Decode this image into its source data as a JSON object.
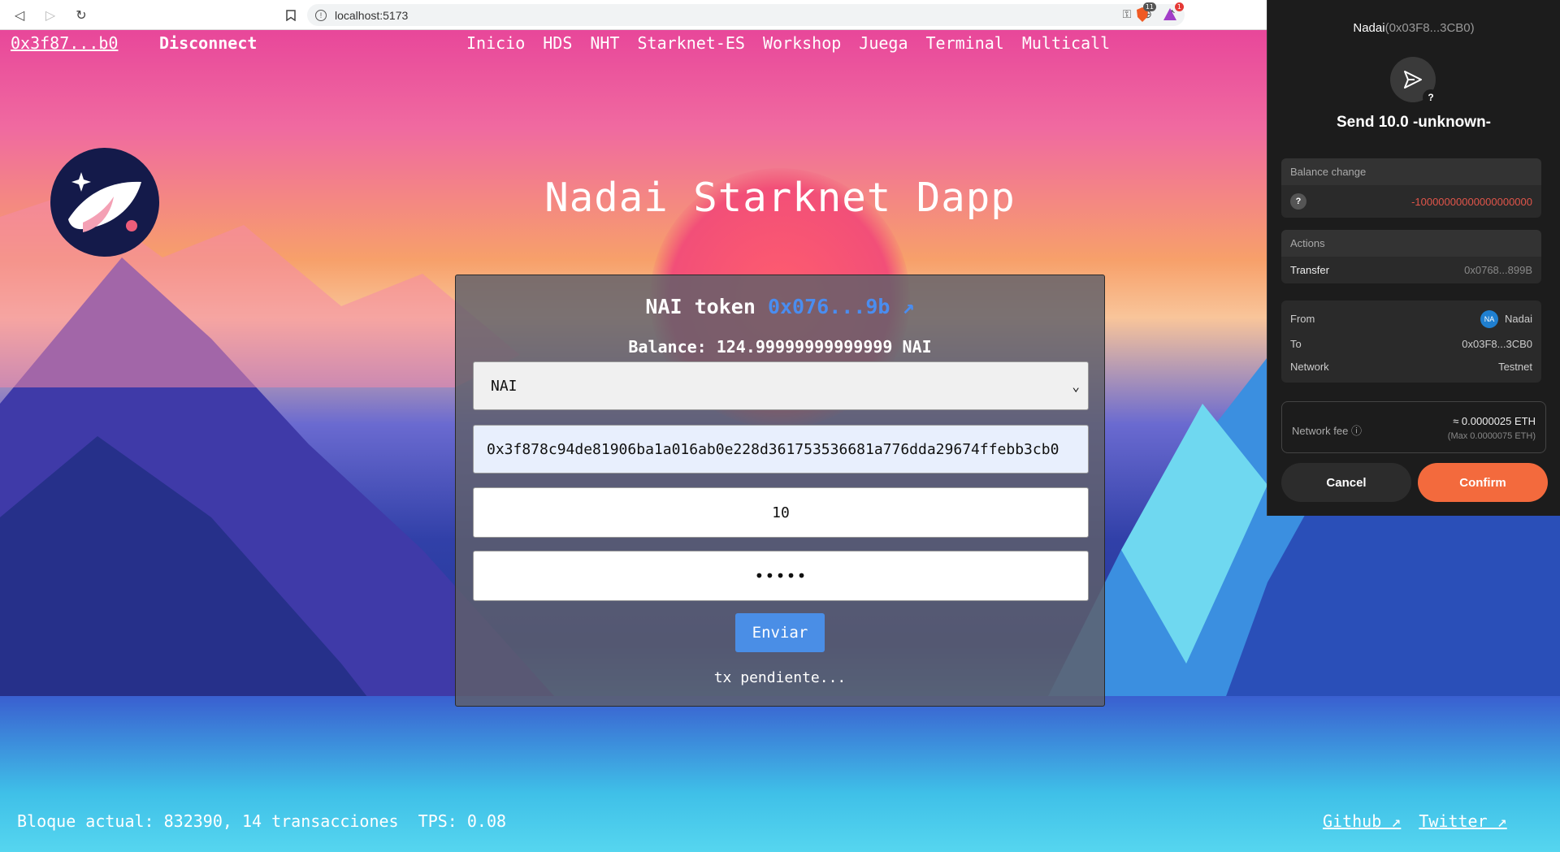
{
  "browser": {
    "url": "localhost:5173",
    "ext_badge_1": "11",
    "ext_badge_2": "1"
  },
  "nav": {
    "wallet_address": "0x3f87...b0",
    "disconnect": "Disconnect",
    "menu": [
      "Inicio",
      "HDS",
      "NHT",
      "Starknet-ES",
      "Workshop",
      "Juega",
      "Terminal",
      "Multicall"
    ]
  },
  "main": {
    "title": "Nadai Starknet Dapp",
    "token_label": "NAI token",
    "token_address": "0x076...9b ↗",
    "balance": "Balance: 124.99999999999999 NAI",
    "selected_token": "NAI",
    "recipient_value": "0x3f878c94de81906ba1a016ab0e228d361753536681a776dda29674ffebb3cb0",
    "amount_value": "10",
    "password_mask": "•••••",
    "send_label": "Enviar",
    "status": "tx pendiente..."
  },
  "footer": {
    "block_info": "Bloque actual: 832390, 14 transacciones  TPS: 0.08",
    "github": "Github ↗",
    "twitter": "Twitter ↗"
  },
  "wallet": {
    "account_name": "Nadai",
    "account_addr": "(0x03F8...3CB0)",
    "title": "Send 10.0 -unknown-",
    "balance_change_label": "Balance change",
    "balance_change_value": "-10000000000000000000",
    "actions_label": "Actions",
    "action_name": "Transfer",
    "action_addr": "0x0768...899B",
    "from_label": "From",
    "from_badge": "NA",
    "from_value": "Nadai",
    "to_label": "To",
    "to_value": "0x03F8...3CB0",
    "network_label": "Network",
    "network_value": "Testnet",
    "fee_label": "Network fee ⓘ",
    "fee_value": "≈ 0.0000025 ETH",
    "fee_max": "(Max 0.0000075 ETH)",
    "cancel": "Cancel",
    "confirm": "Confirm",
    "accent": "#f36a3d"
  }
}
